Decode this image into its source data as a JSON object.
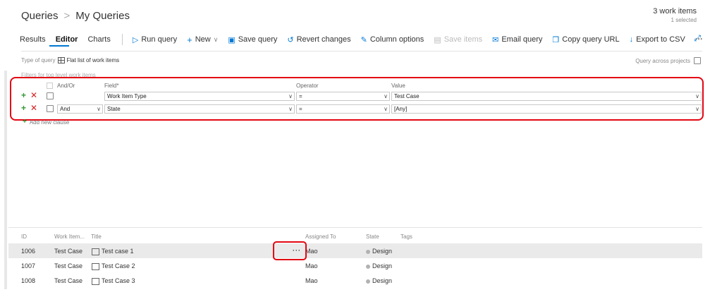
{
  "breadcrumb": {
    "root": "Queries",
    "separator": ">",
    "current": "My Queries"
  },
  "summary": {
    "count": "3 work items",
    "selected": "1 selected"
  },
  "tabs": [
    "Results",
    "Editor",
    "Charts"
  ],
  "toolbar": {
    "run_query": "Run query",
    "new": "New",
    "save_query": "Save query",
    "revert": "Revert changes",
    "column_options": "Column options",
    "save_items": "Save items",
    "email_query": "Email query",
    "copy_url": "Copy query URL",
    "export_csv": "Export to CSV",
    "more": "···"
  },
  "query_type": {
    "label": "Type of query",
    "value": "Flat list of work items"
  },
  "query_across": "Query across projects",
  "filters_label": "Filters for top level work items",
  "clause_headers": {
    "andor": "And/Or",
    "field": "Field*",
    "operator": "Operator",
    "value": "Value"
  },
  "clauses": [
    {
      "andor": "",
      "field": "Work Item Type",
      "operator": "=",
      "value": "Test Case"
    },
    {
      "andor": "And",
      "field": "State",
      "operator": "=",
      "value": "[Any]"
    }
  ],
  "add_clause": "Add new clause",
  "results": {
    "headers": {
      "id": "ID",
      "type": "Work Item...",
      "title": "Title",
      "assigned": "Assigned To",
      "state": "State",
      "tags": "Tags"
    },
    "rows": [
      {
        "id": "1006",
        "type": "Test Case",
        "title": "Test case 1",
        "assigned": "Mao",
        "state": "Design",
        "more": "···"
      },
      {
        "id": "1007",
        "type": "Test Case",
        "title": "Test Case 2",
        "assigned": "Mao",
        "state": "Design"
      },
      {
        "id": "1008",
        "type": "Test Case",
        "title": "Test Case 3",
        "assigned": "Mao",
        "state": "Design"
      }
    ]
  },
  "colors": {
    "accent": "#0078d4",
    "highlight": "#e30613",
    "add": "#339933",
    "remove": "#d82020"
  }
}
